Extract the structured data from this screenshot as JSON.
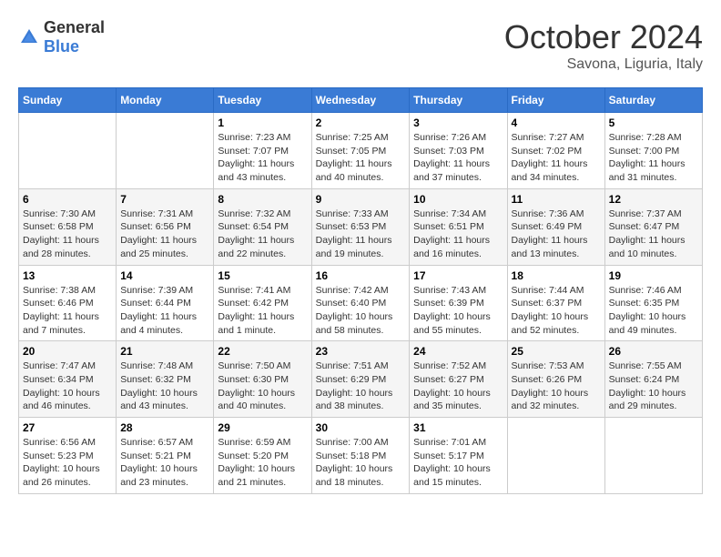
{
  "header": {
    "logo_general": "General",
    "logo_blue": "Blue",
    "month": "October 2024",
    "location": "Savona, Liguria, Italy"
  },
  "weekdays": [
    "Sunday",
    "Monday",
    "Tuesday",
    "Wednesday",
    "Thursday",
    "Friday",
    "Saturday"
  ],
  "weeks": [
    [
      {
        "day": "",
        "info": ""
      },
      {
        "day": "",
        "info": ""
      },
      {
        "day": "1",
        "info": "Sunrise: 7:23 AM\nSunset: 7:07 PM\nDaylight: 11 hours and 43 minutes."
      },
      {
        "day": "2",
        "info": "Sunrise: 7:25 AM\nSunset: 7:05 PM\nDaylight: 11 hours and 40 minutes."
      },
      {
        "day": "3",
        "info": "Sunrise: 7:26 AM\nSunset: 7:03 PM\nDaylight: 11 hours and 37 minutes."
      },
      {
        "day": "4",
        "info": "Sunrise: 7:27 AM\nSunset: 7:02 PM\nDaylight: 11 hours and 34 minutes."
      },
      {
        "day": "5",
        "info": "Sunrise: 7:28 AM\nSunset: 7:00 PM\nDaylight: 11 hours and 31 minutes."
      }
    ],
    [
      {
        "day": "6",
        "info": "Sunrise: 7:30 AM\nSunset: 6:58 PM\nDaylight: 11 hours and 28 minutes."
      },
      {
        "day": "7",
        "info": "Sunrise: 7:31 AM\nSunset: 6:56 PM\nDaylight: 11 hours and 25 minutes."
      },
      {
        "day": "8",
        "info": "Sunrise: 7:32 AM\nSunset: 6:54 PM\nDaylight: 11 hours and 22 minutes."
      },
      {
        "day": "9",
        "info": "Sunrise: 7:33 AM\nSunset: 6:53 PM\nDaylight: 11 hours and 19 minutes."
      },
      {
        "day": "10",
        "info": "Sunrise: 7:34 AM\nSunset: 6:51 PM\nDaylight: 11 hours and 16 minutes."
      },
      {
        "day": "11",
        "info": "Sunrise: 7:36 AM\nSunset: 6:49 PM\nDaylight: 11 hours and 13 minutes."
      },
      {
        "day": "12",
        "info": "Sunrise: 7:37 AM\nSunset: 6:47 PM\nDaylight: 11 hours and 10 minutes."
      }
    ],
    [
      {
        "day": "13",
        "info": "Sunrise: 7:38 AM\nSunset: 6:46 PM\nDaylight: 11 hours and 7 minutes."
      },
      {
        "day": "14",
        "info": "Sunrise: 7:39 AM\nSunset: 6:44 PM\nDaylight: 11 hours and 4 minutes."
      },
      {
        "day": "15",
        "info": "Sunrise: 7:41 AM\nSunset: 6:42 PM\nDaylight: 11 hours and 1 minute."
      },
      {
        "day": "16",
        "info": "Sunrise: 7:42 AM\nSunset: 6:40 PM\nDaylight: 10 hours and 58 minutes."
      },
      {
        "day": "17",
        "info": "Sunrise: 7:43 AM\nSunset: 6:39 PM\nDaylight: 10 hours and 55 minutes."
      },
      {
        "day": "18",
        "info": "Sunrise: 7:44 AM\nSunset: 6:37 PM\nDaylight: 10 hours and 52 minutes."
      },
      {
        "day": "19",
        "info": "Sunrise: 7:46 AM\nSunset: 6:35 PM\nDaylight: 10 hours and 49 minutes."
      }
    ],
    [
      {
        "day": "20",
        "info": "Sunrise: 7:47 AM\nSunset: 6:34 PM\nDaylight: 10 hours and 46 minutes."
      },
      {
        "day": "21",
        "info": "Sunrise: 7:48 AM\nSunset: 6:32 PM\nDaylight: 10 hours and 43 minutes."
      },
      {
        "day": "22",
        "info": "Sunrise: 7:50 AM\nSunset: 6:30 PM\nDaylight: 10 hours and 40 minutes."
      },
      {
        "day": "23",
        "info": "Sunrise: 7:51 AM\nSunset: 6:29 PM\nDaylight: 10 hours and 38 minutes."
      },
      {
        "day": "24",
        "info": "Sunrise: 7:52 AM\nSunset: 6:27 PM\nDaylight: 10 hours and 35 minutes."
      },
      {
        "day": "25",
        "info": "Sunrise: 7:53 AM\nSunset: 6:26 PM\nDaylight: 10 hours and 32 minutes."
      },
      {
        "day": "26",
        "info": "Sunrise: 7:55 AM\nSunset: 6:24 PM\nDaylight: 10 hours and 29 minutes."
      }
    ],
    [
      {
        "day": "27",
        "info": "Sunrise: 6:56 AM\nSunset: 5:23 PM\nDaylight: 10 hours and 26 minutes."
      },
      {
        "day": "28",
        "info": "Sunrise: 6:57 AM\nSunset: 5:21 PM\nDaylight: 10 hours and 23 minutes."
      },
      {
        "day": "29",
        "info": "Sunrise: 6:59 AM\nSunset: 5:20 PM\nDaylight: 10 hours and 21 minutes."
      },
      {
        "day": "30",
        "info": "Sunrise: 7:00 AM\nSunset: 5:18 PM\nDaylight: 10 hours and 18 minutes."
      },
      {
        "day": "31",
        "info": "Sunrise: 7:01 AM\nSunset: 5:17 PM\nDaylight: 10 hours and 15 minutes."
      },
      {
        "day": "",
        "info": ""
      },
      {
        "day": "",
        "info": ""
      }
    ]
  ]
}
